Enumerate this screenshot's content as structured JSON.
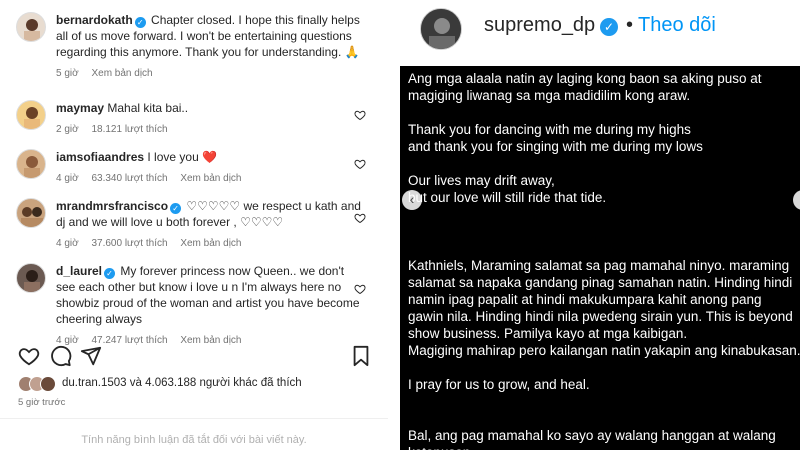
{
  "left": {
    "caption": {
      "user": "bernardokath",
      "text": "Chapter closed. I hope this finally helps all of us move forward. I won't be entertaining questions regarding this anymore. Thank you for understanding. 🙏",
      "time": "5 giờ",
      "translate": "Xem bản dịch"
    },
    "comments": [
      {
        "user": "maymay",
        "text": "Mahal kita bai..",
        "time": "2 giờ",
        "likes": "18.121 lượt thích",
        "translate": ""
      },
      {
        "user": "iamsofiaandres",
        "text": "I love you ❤️",
        "time": "4 giờ",
        "likes": "63.340 lượt thích",
        "translate": "Xem bản dịch"
      },
      {
        "user": "mrandmrsfrancisco",
        "text": "♡♡♡♡♡ we respect u kath and dj and we will love u both forever , ♡♡♡♡",
        "time": "4 giờ",
        "likes": "37.600 lượt thích",
        "translate": "Xem bản dịch"
      },
      {
        "user": "d_laurel",
        "text": "My forever princess now Queen.. we don't see each other but know i love u n I'm always here no showbiz proud of the woman and artist you have become cheering always",
        "time": "4 giờ",
        "likes": "47.247 lượt thích",
        "translate": "Xem bản dịch"
      }
    ],
    "likes_text": "du.tran.1503 và 4.063.188 người khác đã thích",
    "time_ago": "5 giờ trước",
    "comments_disabled": "Tính năng bình luận đã tắt đối với bài viết này."
  },
  "right": {
    "username": "supremo_dp",
    "dot": "•",
    "follow": "Theo dõi",
    "post_lines": [
      "Ang mga alaala natin ay laging kong baon sa aking puso  at",
      "magiging liwanag sa mga madidilim kong araw.",
      "",
      "Thank you for dancing with me during my highs",
      "and thank you for singing with me during my lows",
      "",
      "Our lives may drift away,",
      "but our love will still ride that tide.",
      "",
      "",
      "",
      "Kathniels, Maraming salamat sa pag mamahal ninyo. maraming",
      "salamat sa napaka gandang pinag samahan natin. Hinding hindi",
      "namin ipag papalit at hindi makukumpara kahit anong pang",
      "gawin nila. Hinding hindi nila pwedeng sirain yun. This is beyond",
      "show business. Pamilya kayo at mga kaibigan.",
      "Magiging mahirap pero kailangan natin yakapin ang kinabukasan.",
      "",
      "I pray for us to grow, and heal.",
      "",
      "",
      "Bal, ang pag mamahal ko sayo ay walang hanggan at walang",
      "katapusan."
    ]
  },
  "colors": {
    "verified": "#1d9bf0",
    "follow": "#0095f6",
    "heart": "#ed4956"
  }
}
